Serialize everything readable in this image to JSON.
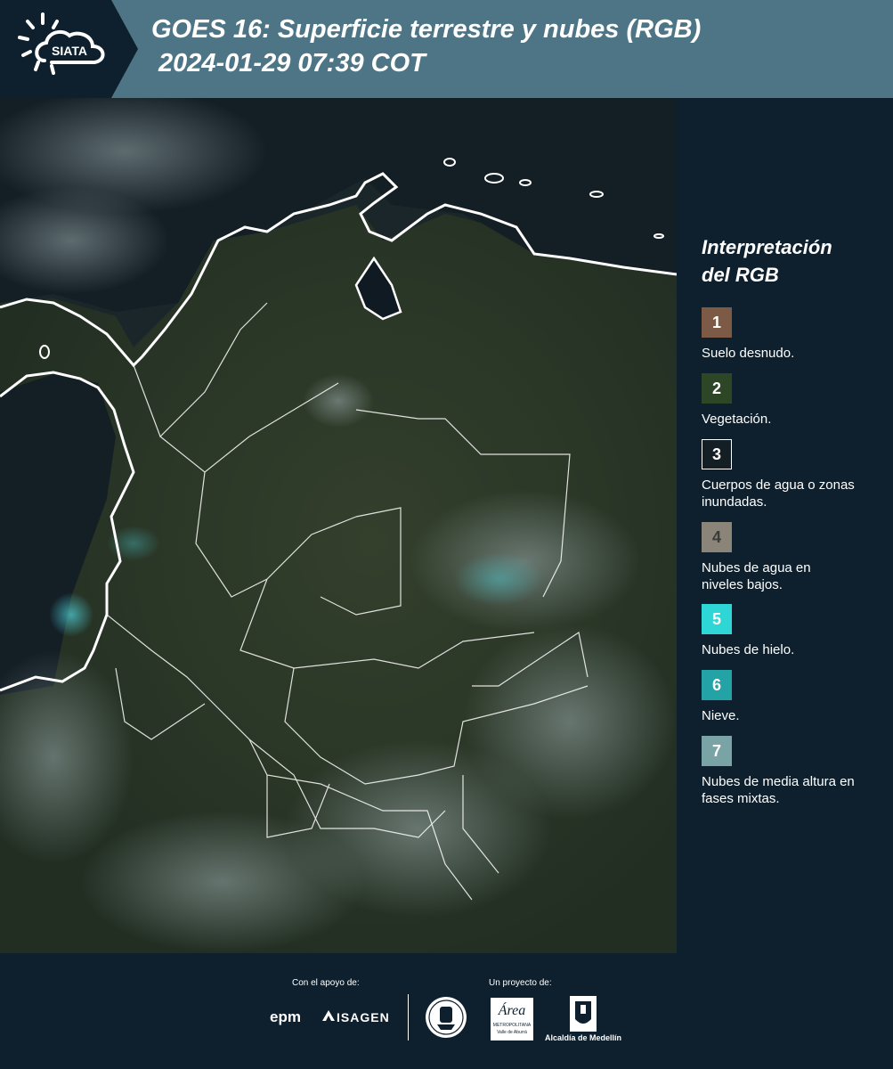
{
  "header": {
    "logo_text": "SIATA",
    "title_line1": "GOES 16: Superficie terrestre y nubes (RGB)",
    "title_line2": "2024-01-29 07:39 COT"
  },
  "legend": {
    "title_line1": "Interpretación",
    "title_line2": "del RGB",
    "items": [
      {
        "number": "1",
        "label": "Suelo desnudo.",
        "color": "#7d5a45"
      },
      {
        "number": "2",
        "label": "Vegetación.",
        "color": "#2c4626"
      },
      {
        "number": "3",
        "label": "Cuerpos de agua o zonas inundadas.",
        "color": "#141e25"
      },
      {
        "number": "4",
        "label": "Nubes de agua en niveles bajos.",
        "color": "#8a8479"
      },
      {
        "number": "5",
        "label": "Nubes de hielo.",
        "color": "#2fd6d6"
      },
      {
        "number": "6",
        "label": "Nieve.",
        "color": "#23a3a5"
      },
      {
        "number": "7",
        "label": "Nubes de media altura en fases mixtas.",
        "color": "#7aa3a6"
      }
    ]
  },
  "footer": {
    "support_label": "Con el apoyo de:",
    "project_label": "Un proyecto de:",
    "epm": "epm",
    "isagen": "ISAGEN",
    "area_main": "Área",
    "area_sub1": "METROPOLITANA",
    "area_sub2": "Valle de Aburrá",
    "alcaldia": "Alcaldía de Medellín"
  }
}
